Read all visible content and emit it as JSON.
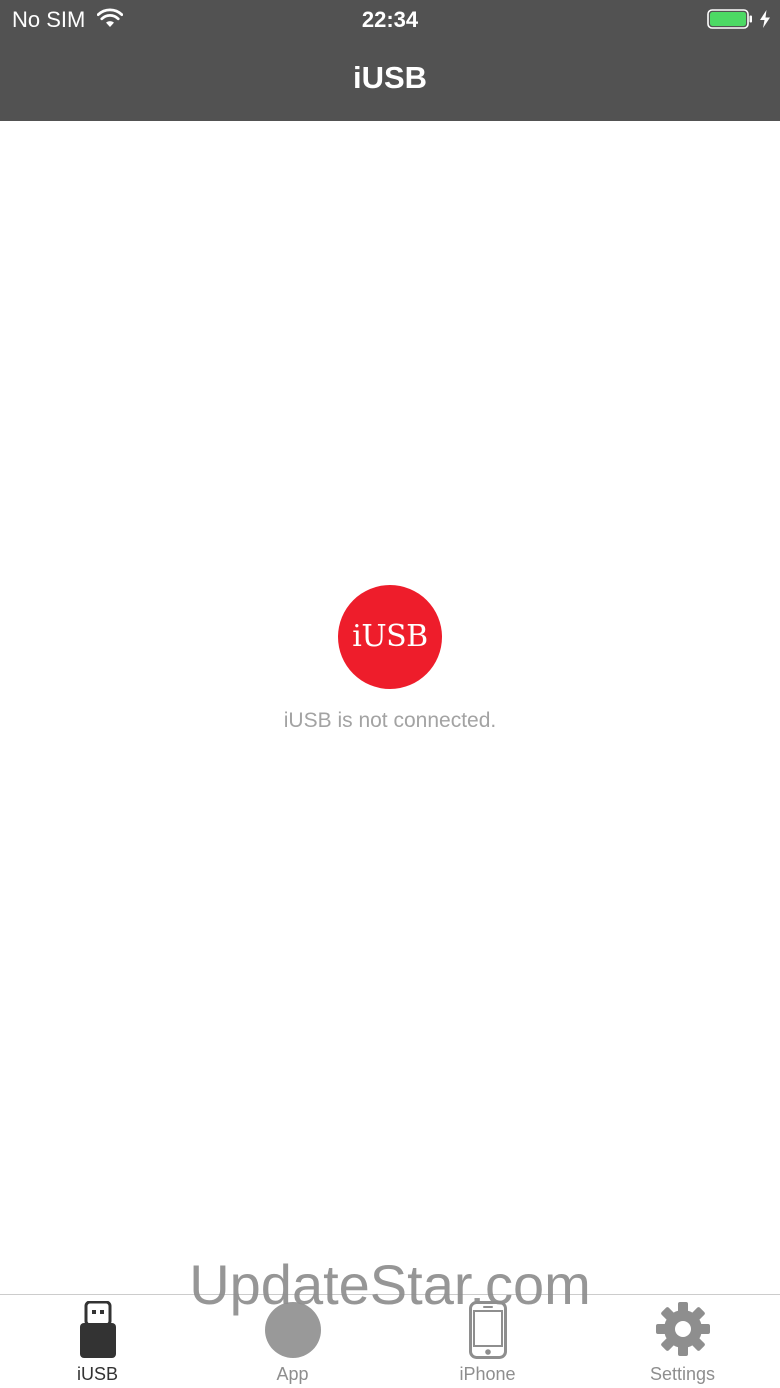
{
  "status_bar": {
    "carrier": "No SIM",
    "time": "22:34",
    "wifi_icon": "wifi-icon",
    "battery_icon": "battery-icon",
    "charging_icon": "charging-bolt-icon",
    "battery_color": "#4cd964"
  },
  "nav_bar": {
    "title": "iUSB",
    "background": "#525252"
  },
  "main": {
    "logo_text": "iUSB",
    "logo_color": "#ee1d2b",
    "message": "iUSB is not connected."
  },
  "watermark": {
    "text": "UpdateStar.com"
  },
  "tab_bar": {
    "tabs": [
      {
        "label": "iUSB",
        "icon": "usb-drive-icon",
        "selected": true
      },
      {
        "label": "App",
        "icon": "app-circle-icon",
        "selected": false
      },
      {
        "label": "iPhone",
        "icon": "iphone-icon",
        "selected": false
      },
      {
        "label": "Settings",
        "icon": "gear-icon",
        "selected": false
      }
    ]
  }
}
